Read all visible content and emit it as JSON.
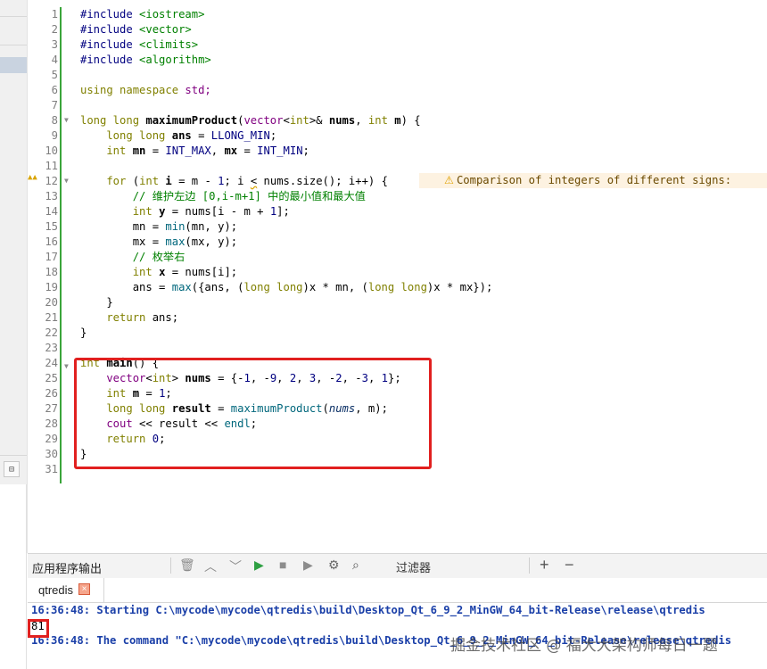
{
  "line_numbers": [
    "1",
    "2",
    "3",
    "4",
    "5",
    "6",
    "7",
    "8",
    "9",
    "10",
    "11",
    "12",
    "13",
    "14",
    "15",
    "16",
    "17",
    "18",
    "19",
    "20",
    "21",
    "22",
    "23",
    "24",
    "25",
    "26",
    "27",
    "28",
    "29",
    "30",
    "31"
  ],
  "code": {
    "l1_a": "#include ",
    "l1_b": "<iostream>",
    "l2_a": "#include ",
    "l2_b": "<vector>",
    "l3_a": "#include ",
    "l3_b": "<climits>",
    "l4_a": "#include ",
    "l4_b": "<algorithm>",
    "l6_a": "using",
    "l6_b": " namespace",
    "l6_c": " std;",
    "l8_a": "long long ",
    "l8_b": "maximumProduct",
    "l8_c": "(",
    "l8_d": "vector",
    "l8_e": "<",
    "l8_f": "int",
    "l8_g": ">& ",
    "l8_h": "nums",
    "l8_i": ", ",
    "l8_j": "int ",
    "l8_k": "m",
    "l8_l": ") {",
    "l9_a": "    long long ",
    "l9_b": "ans",
    "l9_c": " = ",
    "l9_d": "LLONG_MIN",
    "l9_e": ";",
    "l10_a": "    int ",
    "l10_b": "mn",
    "l10_c": " = ",
    "l10_d": "INT_MAX",
    "l10_e": ", ",
    "l10_f": "mx",
    "l10_g": " = ",
    "l10_h": "INT_MIN",
    "l10_i": ";",
    "l12_a": "    for",
    "l12_b": " (",
    "l12_c": "int ",
    "l12_d": "i",
    "l12_e": " = m - ",
    "l12_f": "1",
    "l12_g": "; i ",
    "l12_h": "<",
    "l12_i": " nums.size(); i++) {",
    "l13": "        // 维护左边 [0,i-m+1] 中的最小值和最大值",
    "l14_a": "        int ",
    "l14_b": "y",
    "l14_c": " = nums[i - m + ",
    "l14_d": "1",
    "l14_e": "];",
    "l15_a": "        mn = ",
    "l15_b": "min",
    "l15_c": "(mn, y);",
    "l16_a": "        mx = ",
    "l16_b": "max",
    "l16_c": "(mx, y);",
    "l17": "        // 枚举右",
    "l18_a": "        int ",
    "l18_b": "x",
    "l18_c": " = nums[i];",
    "l19_a": "        ans = ",
    "l19_b": "max",
    "l19_c": "({ans, (",
    "l19_d": "long long",
    "l19_e": ")x * mn, (",
    "l19_f": "long long",
    "l19_g": ")x * mx});",
    "l20": "    }",
    "l21_a": "    return",
    "l21_b": " ans;",
    "l22": "}",
    "l24_a": "int ",
    "l24_b": "main",
    "l24_c": "() {",
    "l25_a": "    vector",
    "l25_b": "<",
    "l25_c": "int",
    "l25_d": "> ",
    "l25_e": "nums",
    "l25_f": " = {-",
    "l25_g": "1",
    "l25_h": ", -",
    "l25_i": "9",
    "l25_j": ", ",
    "l25_k": "2",
    "l25_l": ", ",
    "l25_m": "3",
    "l25_n": ", -",
    "l25_o": "2",
    "l25_p": ", -",
    "l25_q": "3",
    "l25_r": ", ",
    "l25_s": "1",
    "l25_t": "};",
    "l26_a": "    int ",
    "l26_b": "m",
    "l26_c": " = ",
    "l26_d": "1",
    "l26_e": ";",
    "l27_a": "    long long ",
    "l27_b": "result",
    "l27_c": " = ",
    "l27_d": "maximumProduct",
    "l27_e": "(",
    "l27_f": "nums",
    "l27_g": ", m);",
    "l28_a": "    cout",
    "l28_b": " << result << ",
    "l28_c": "endl",
    "l28_d": ";",
    "l29_a": "    return",
    "l29_b": " ",
    "l29_c": "0",
    "l29_d": ";",
    "l30": "}"
  },
  "warning": {
    "text": "Comparison of integers of different signs: "
  },
  "output_pane": {
    "title": "应用程序输出",
    "filter_label": "过滤器",
    "tab_label": "qtredis",
    "tab_close": "×",
    "lines": {
      "l1": "16:36:48: Starting C:\\mycode\\mycode\\qtredis\\build\\Desktop_Qt_6_9_2_MinGW_64_bit-Release\\release\\qtredis",
      "l2": "81",
      "l3": "16:36:48: The command \"C:\\mycode\\mycode\\qtredis\\build\\Desktop_Qt_6_9_2_MinGW_64_bit-Release\\release\\qtredis"
    }
  },
  "watermark": "掘金技术社区 @ 福大大架构师每日一题",
  "colors": {
    "keyword": "#808000",
    "type": "#800080",
    "function": "#00677c",
    "number": "#000080",
    "comment": "#008000",
    "highlight_box": "#e1201f",
    "output_blue": "#1a3fa8",
    "gutter_marker": "#3aa53a"
  },
  "icons": {
    "fold": "fold-triangle-icon",
    "warning": "warning-triangle-icon",
    "trash": "trash-icon",
    "up": "chevron-up-icon",
    "down": "chevron-down-icon",
    "run": "run-icon",
    "stop": "stop-icon",
    "debug": "debug-icon",
    "settings": "gear-icon",
    "search": "search-icon",
    "add": "plus-icon",
    "remove": "minus-icon",
    "close": "close-icon"
  }
}
